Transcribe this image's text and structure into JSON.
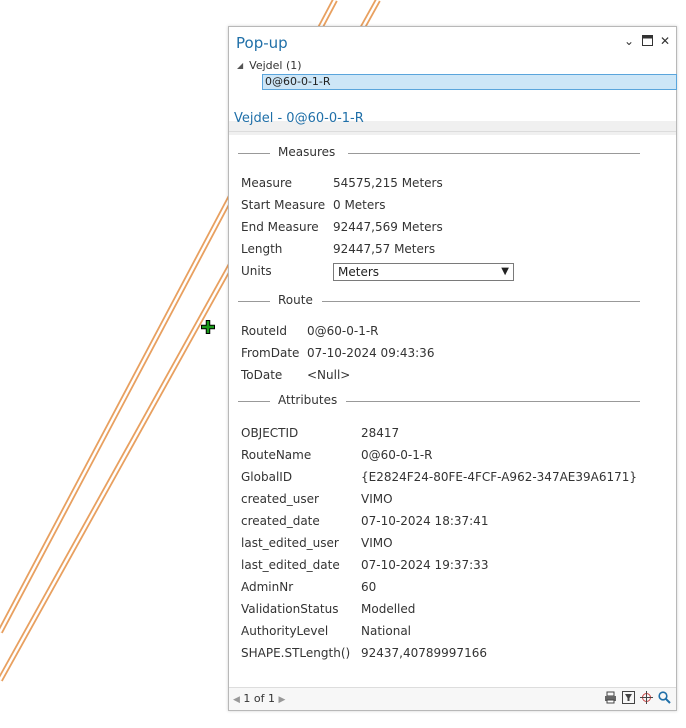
{
  "popup": {
    "title": "Pop-up",
    "window_buttons": {
      "menu_icon": "chevron-down-icon",
      "maximize_icon": "maximize-icon",
      "close_icon": "close-icon"
    },
    "tree": {
      "layer": "Vejdel (1)",
      "feature": "0@60-0-1-R"
    },
    "feature_header": "Vejdel - 0@60-0-1-R",
    "measures": {
      "heading": "Measures",
      "rows": [
        {
          "key": "Measure",
          "value": "54575,215 Meters"
        },
        {
          "key": "Start Measure",
          "value": "0 Meters"
        },
        {
          "key": "End Measure",
          "value": "92447,569 Meters"
        },
        {
          "key": "Length",
          "value": "92447,57 Meters"
        }
      ],
      "units_label": "Units",
      "units_value": "Meters"
    },
    "route": {
      "heading": "Route",
      "rows": [
        {
          "key": "RouteId",
          "value": "0@60-0-1-R"
        },
        {
          "key": "FromDate",
          "value": "07-10-2024 09:43:36"
        },
        {
          "key": "ToDate",
          "value": "<Null>"
        }
      ]
    },
    "attributes": {
      "heading": "Attributes",
      "rows": [
        {
          "key": "OBJECTID",
          "value": "28417"
        },
        {
          "key": "RouteName",
          "value": "0@60-0-1-R"
        },
        {
          "key": "GlobalID",
          "value": "{E2824F24-80FE-4FCF-A962-347AE39A6171}"
        },
        {
          "key": "created_user",
          "value": "VIMO"
        },
        {
          "key": "created_date",
          "value": "07-10-2024 18:37:41"
        },
        {
          "key": "last_edited_user",
          "value": "VIMO"
        },
        {
          "key": "last_edited_date",
          "value": "07-10-2024 19:37:33"
        },
        {
          "key": "AdminNr",
          "value": "60"
        },
        {
          "key": "ValidationStatus",
          "value": "Modelled"
        },
        {
          "key": "AuthorityLevel",
          "value": "National"
        },
        {
          "key": "SHAPE.STLength()",
          "value": "92437,40789997166"
        }
      ]
    },
    "footer": {
      "pager": "1 of 1",
      "icons": [
        "print-icon",
        "filter-icon",
        "zoom-to-icon",
        "search-icon"
      ]
    }
  },
  "colors": {
    "accent": "#1f6fa8",
    "road": "#e8a060",
    "marker": "#1a9a1a"
  }
}
